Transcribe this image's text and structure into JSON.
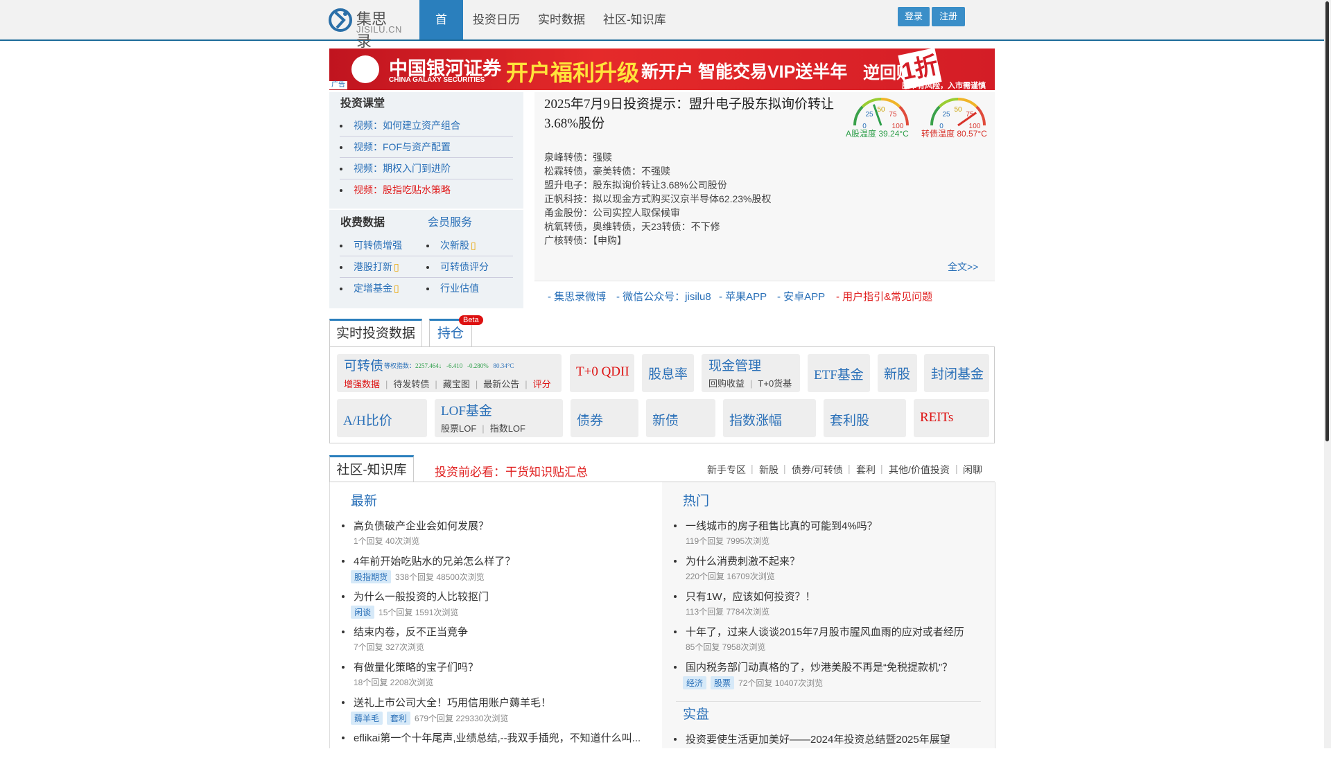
{
  "nav": {
    "logo_cn": "集思录",
    "logo_en": "JISILU.CN",
    "items": [
      "首页",
      "投资日历",
      "实时数据",
      "社区-知识库"
    ],
    "login": "登录",
    "register": "注册"
  },
  "banner": {
    "brand": "中国银河证券",
    "brand_en": "CHINA GALAXY SECURITIES",
    "promo1": "开户福利升级",
    "promo2": "新开户 智能交易VIP送半年",
    "promo3": "逆回购",
    "promo_big": "1折",
    "risk_note": "股市有风险，入市需谨慎",
    "ad_tag": "广告"
  },
  "left": {
    "course_head": "投资课堂",
    "courses": [
      {
        "label": "视频：如何建立资产组合",
        "red": false
      },
      {
        "label": "视频：FOF与资产配置",
        "red": false
      },
      {
        "label": "视频：期权入门到进阶",
        "red": false
      },
      {
        "label": "视频：股指吃贴水策略",
        "red": true
      }
    ],
    "paid_head": "收费数据",
    "member_head": "会员服务",
    "paid": [
      {
        "label": "可转债增强",
        "lock": false
      },
      {
        "label": "次新股",
        "lock": true
      },
      {
        "label": "港股打新",
        "lock": true
      },
      {
        "label": "可转债评分",
        "lock": false
      },
      {
        "label": "定增基金",
        "lock": true
      },
      {
        "label": "行业估值",
        "lock": false
      }
    ]
  },
  "article": {
    "title": "2025年7月9日投资提示：盟升电子股东拟询价转让3.68%股份",
    "lines": [
      "泉峰转债：强赎",
      "松霖转债，豪美转债：不强赎",
      "盟升电子：股东拟询价转让3.68%公司股份",
      "正帆科技：拟以现金方式购买汉京半导体62.23%股权",
      "甬金股份：公司实控人取保候审",
      "杭氧转债，奥维转债，天23转债：不下修",
      "广核转债：【申购】"
    ],
    "read_more": "全文>>",
    "links": [
      {
        "label": "- 集思录微博",
        "red": false
      },
      {
        "label": "- 微信公众号：jisilu8",
        "red": false
      },
      {
        "label": "- 苹果APP",
        "red": false
      },
      {
        "label": "- 安卓APP",
        "red": false
      },
      {
        "label": "- 用户指引&常见问题",
        "red": true
      }
    ]
  },
  "gauges": [
    {
      "label": "A股温度 39.24°C",
      "value": 39.24,
      "color": "#2e9f4a",
      "ticks": [
        "0",
        "25",
        "50",
        "75",
        "100"
      ]
    },
    {
      "label": "转债温度 80.57°C",
      "value": 80.57,
      "color": "#d8332b",
      "ticks": [
        "0",
        "25",
        "50",
        "75",
        "100"
      ]
    }
  ],
  "realtime": {
    "tab_data": "实时投资数据",
    "tab_holding": "持仓",
    "beta": "Beta",
    "cb": {
      "title": "可转债",
      "index_label": "等权指数：",
      "index_value": "2257.464↓",
      "change": "-6.410",
      "change_pct": "-0.280%",
      "temp": "80.34°C",
      "subs": [
        "增强数据",
        "待发转债",
        "藏宝图",
        "最新公告",
        "评分"
      ]
    },
    "t0qdii": "T+0 QDII",
    "dividend": "股息率",
    "cash": {
      "title": "现金管理",
      "subs": [
        "回购收益",
        "T+0货基"
      ]
    },
    "etf": "ETF基金",
    "ipo": "新股",
    "closed_fund": "封闭基金",
    "ah": "A/H比价",
    "lof": {
      "title": "LOF基金",
      "subs": [
        "股票LOF",
        "指数LOF"
      ]
    },
    "bond": "债券",
    "new_bond": "新债",
    "index_change": "指数涨幅",
    "arb": "套利股",
    "reits": "REITs"
  },
  "community": {
    "tab": "社区-知识库",
    "must_read": "投资前必看：干货知识贴汇总",
    "links": [
      "新手专区",
      "新股",
      "债券/可转债",
      "套利",
      "其他/价值投资",
      "闲聊"
    ],
    "latest_head": "最新",
    "hot_head": "热门",
    "real_head": "实盘",
    "latest": [
      {
        "title": "高负债破产企业会如何发展？",
        "tags": [],
        "meta": "1个回复  40次浏览"
      },
      {
        "title": "4年前开始吃贴水的兄弟怎么样了？",
        "tags": [
          "股指期货"
        ],
        "meta": "338个回复  48500次浏览"
      },
      {
        "title": "为什么一般投资的人比较抠门",
        "tags": [
          "闲谈"
        ],
        "meta": "15个回复  1591次浏览"
      },
      {
        "title": "结束内卷，反不正当竞争",
        "tags": [],
        "meta": "7个回复  327次浏览"
      },
      {
        "title": "有做量化策略的宝子们吗？",
        "tags": [],
        "meta": "18个回复  2208次浏览"
      },
      {
        "title": "送礼上市公司大全！巧用信用账户薅羊毛！",
        "tags": [
          "薅羊毛",
          "套利"
        ],
        "meta": "679个回复  229330次浏览"
      },
      {
        "title": "eflikai第一个十年尾声,业绩总结,--我双手插兜，不知道什么叫...",
        "tags": [],
        "meta": ""
      }
    ],
    "hot": [
      {
        "title": "一线城市的房子租售比真的可能到4%吗？",
        "tags": [],
        "meta": "119个回复  7995次浏览"
      },
      {
        "title": "为什么消费刺激不起来？",
        "tags": [],
        "meta": "220个回复  16709次浏览"
      },
      {
        "title": "只有1W，应该如何投资？！",
        "tags": [],
        "meta": "113个回复  7784次浏览"
      },
      {
        "title": "十年了，过来人谈谈2015年7月股市腥风血雨的应对或者经历",
        "tags": [],
        "meta": "85个回复  7958次浏览"
      },
      {
        "title": "国内税务部门动真格的了，炒港美股不再是“免税提款机”？",
        "tags": [
          "经济",
          "股票"
        ],
        "meta": "72个回复  10407次浏览"
      }
    ],
    "real": [
      {
        "title": "投资要使生活更加美好——2024年投资总结暨2025年展望",
        "tags": [],
        "meta": ""
      }
    ]
  }
}
